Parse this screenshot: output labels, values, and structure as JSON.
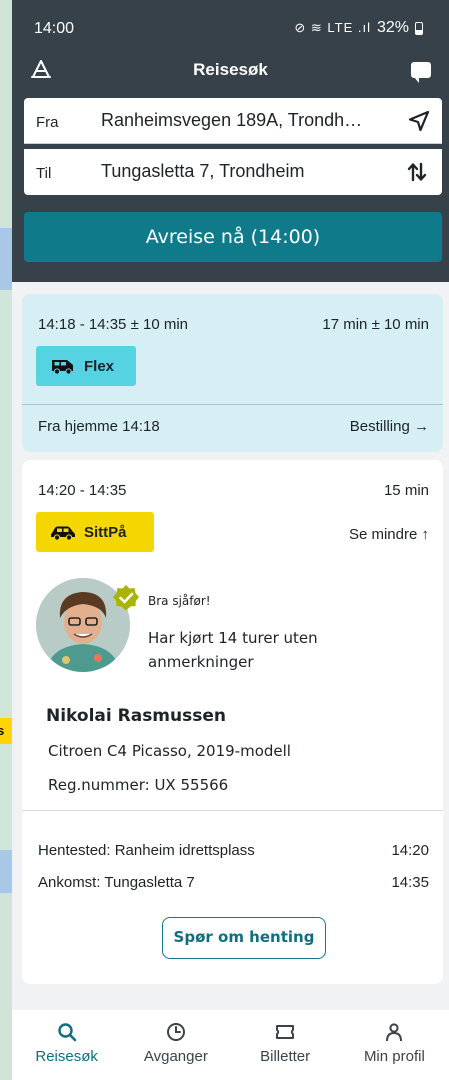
{
  "status_bar": {
    "time": "14:00",
    "icons": "⊘ ≋ LTE .ıl",
    "battery": "32%"
  },
  "header": {
    "title": "Reisesøk"
  },
  "search": {
    "from_label": "Fra",
    "from_value": "Ranheimsvegen 189A, Trondh…",
    "to_label": "Til",
    "to_value": "Tungasletta 7, Trondheim",
    "depart_label": "Avreise nå (14:00)"
  },
  "map": {
    "label_fragment": "s"
  },
  "trips": [
    {
      "time_range": "14:18 - 14:35 ± 10 min",
      "duration": "17 min ± 10 min",
      "badge": "Flex",
      "from_text": "Fra hjemme 14:18",
      "booking_label": "Bestilling →"
    },
    {
      "time_range": "14:20 - 14:35",
      "duration": "15 min",
      "badge": "SittPå",
      "see_less": "Se mindre ↑",
      "driver": {
        "badge_text": "Bra sjåfør!",
        "record": "Har kjørt 14 turer uten anmerkninger",
        "name": "Nikolai Rasmussen",
        "car": "Citroen C4 Picasso, 2019-modell",
        "reg": "Reg.nummer: UX 55566"
      },
      "pickup_place": "Hentested: Ranheim idrettsplass",
      "pickup_time": "14:20",
      "arrival_place": "Ankomst: Tungasletta 7",
      "arrival_time": "14:35",
      "ask_button": "Spør om henting"
    }
  ],
  "bottom_nav": [
    {
      "label": "Reisesøk",
      "icon": "search-icon",
      "active": true
    },
    {
      "label": "Avganger",
      "icon": "clock-icon",
      "active": false
    },
    {
      "label": "Billetter",
      "icon": "ticket-icon",
      "active": false
    },
    {
      "label": "Min profil",
      "icon": "person-icon",
      "active": false
    }
  ],
  "colors": {
    "header_bg": "#37414a",
    "primary": "#0f7a8a",
    "flex_badge": "#55d3e3",
    "flex_card": "#d6eff4",
    "sittpa_badge": "#f4d600",
    "verified": "#a8b400"
  }
}
